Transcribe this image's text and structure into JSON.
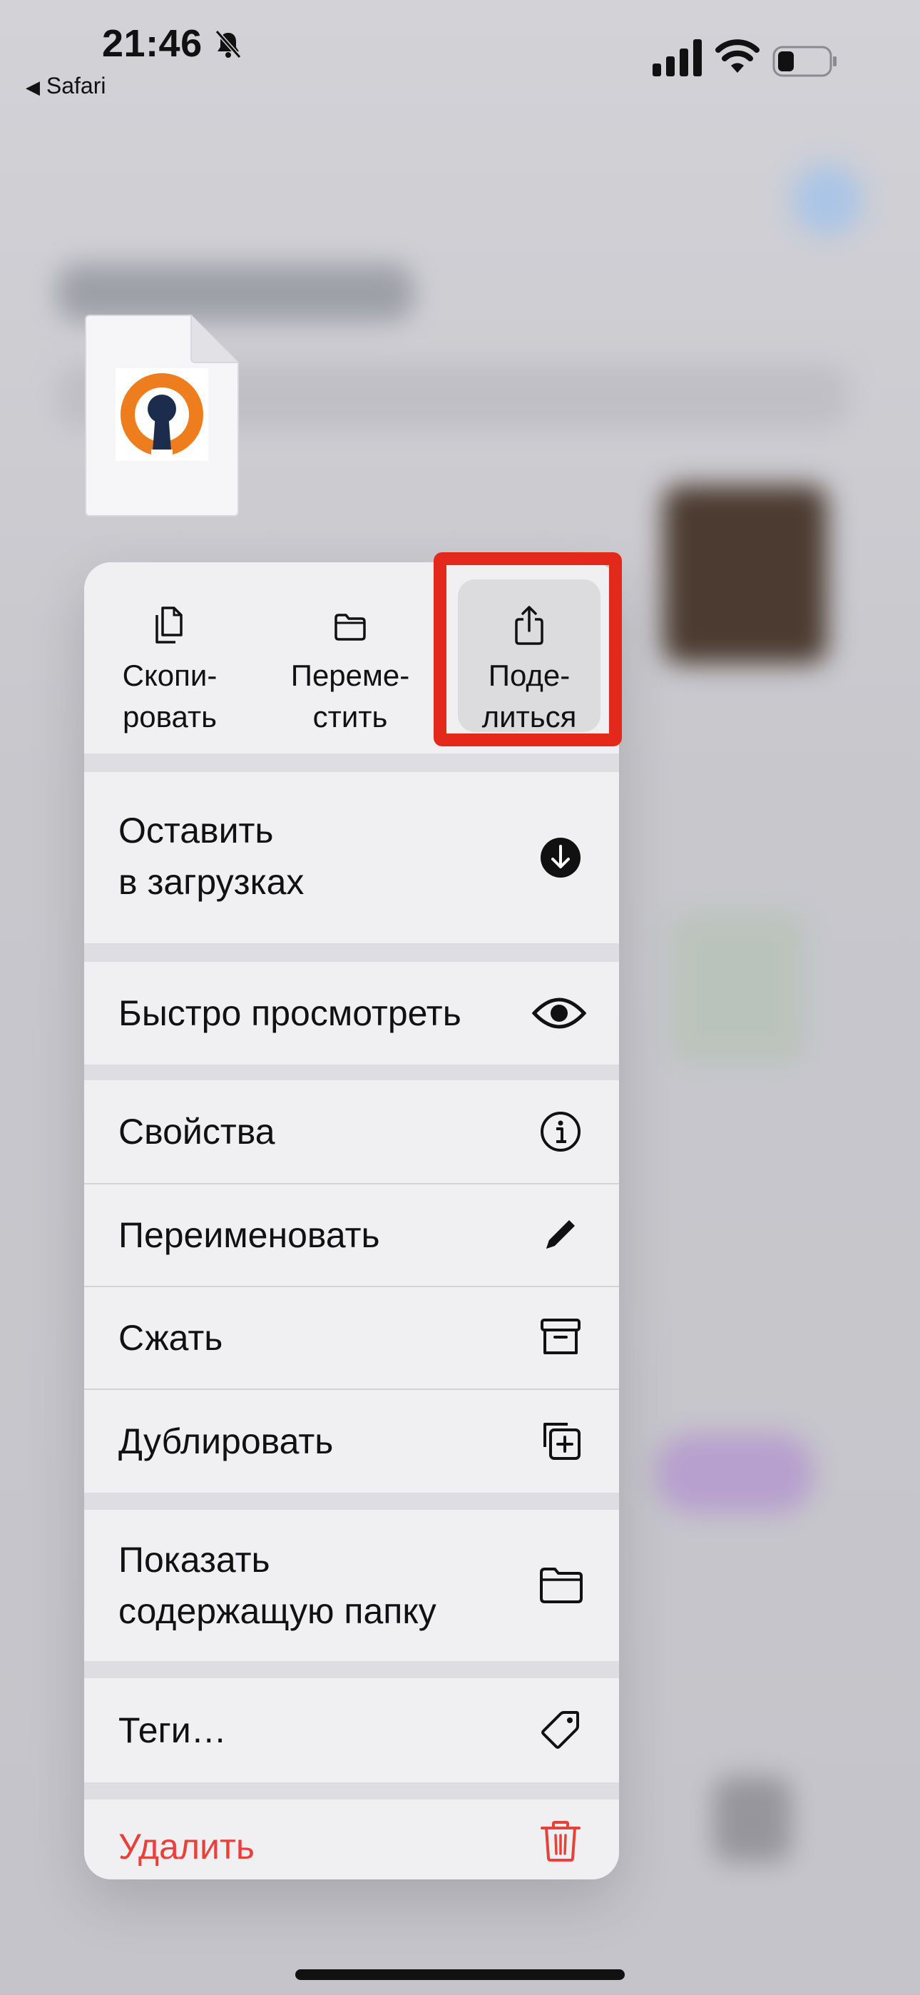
{
  "status": {
    "time": "21:46",
    "back_app": "Safari"
  },
  "menu": {
    "top_actions": [
      {
        "label": "Скопи-\nровать",
        "icon": "copy-documents-icon"
      },
      {
        "label": "Переме-\nстить",
        "icon": "folder-icon"
      },
      {
        "label": "Поде-\nлиться",
        "icon": "share-icon"
      }
    ],
    "items": [
      {
        "label": "Оставить\nв загрузках",
        "icon": "download-circle-icon"
      },
      {
        "label": "Быстро просмотреть",
        "icon": "eye-icon"
      },
      {
        "label": "Свойства",
        "icon": "info-icon"
      },
      {
        "label": "Переименовать",
        "icon": "pencil-icon"
      },
      {
        "label": "Сжать",
        "icon": "archive-box-icon"
      },
      {
        "label": "Дублировать",
        "icon": "duplicate-icon"
      },
      {
        "label": "Показать\nсодержащую папку",
        "icon": "folder-icon"
      },
      {
        "label": "Теги…",
        "icon": "tag-icon"
      },
      {
        "label": "Удалить",
        "icon": "trash-icon"
      }
    ]
  },
  "colors": {
    "highlight": "#e3281c",
    "danger": "#e8413a",
    "openvpn_orange": "#ee7d1e",
    "openvpn_navy": "#1b2c4c"
  }
}
